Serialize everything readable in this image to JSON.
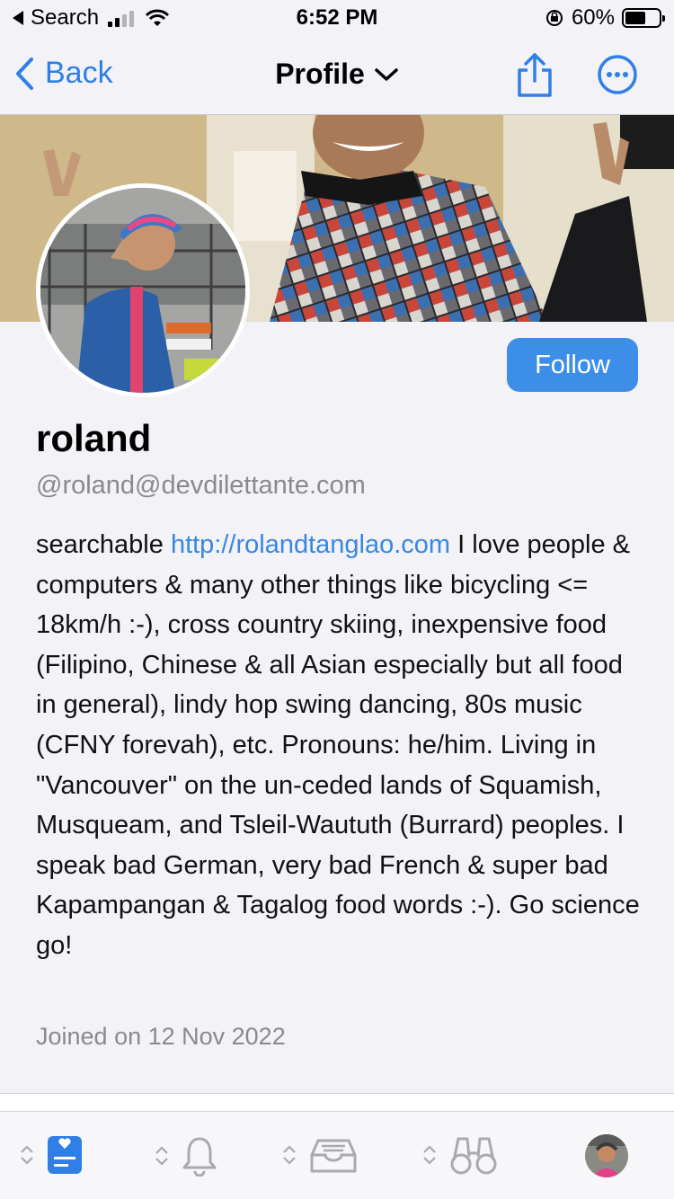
{
  "status_bar": {
    "back_label": "Search",
    "time": "6:52 PM",
    "battery": "60%",
    "battery_level": 0.6
  },
  "nav": {
    "back_label": "Back",
    "title": "Profile"
  },
  "profile": {
    "follow_label": "Follow",
    "display_name": "roland",
    "handle": "@roland@devdilettante.com",
    "bio_prefix": "searchable ",
    "bio_link": "http://rolandtanglao.com",
    "bio_rest": " I love people & computers & many other things like bicycling <= 18km/h :-), cross country skiing, inexpensive food (Filipino, Chinese & all Asian especially but all food in general), lindy hop swing dancing, 80s music (CFNY forevah), etc. Pronouns: he/him.  Living in \"Vancouver\" on the un-ceded lands of Squamish, Musqueam, and Tsleil-Waututh (Burrard) peoples. I speak bad German, very bad French & super bad Kapampangan & Tagalog food words :-). Go science  go!",
    "joined": "Joined on 12 Nov 2022"
  },
  "tabs": [
    {
      "icon": "timeline-icon",
      "active": true
    },
    {
      "icon": "bell-icon",
      "active": false
    },
    {
      "icon": "inbox-icon",
      "active": false
    },
    {
      "icon": "binoculars-icon",
      "active": false
    },
    {
      "icon": "account-avatar",
      "active": false
    }
  ],
  "colors": {
    "accent": "#2f7fe6",
    "follow_bg": "#3d8ee9",
    "bg": "#f2f2f7",
    "secondary_text": "#8a8a8e"
  }
}
